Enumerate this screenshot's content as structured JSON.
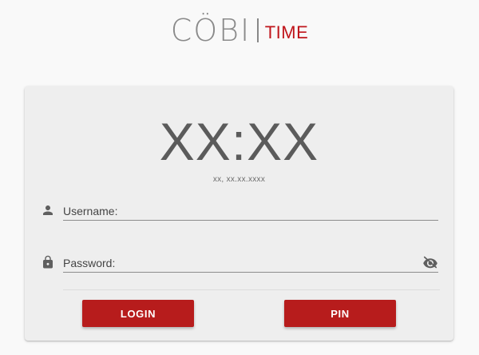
{
  "brand": {
    "logo_main": "CÖBI",
    "logo_sub": "TIME",
    "accent_color": "#c0161c"
  },
  "clock": {
    "time": "XX:XX",
    "date": "xx, xx.xx.xxxx"
  },
  "form": {
    "username_placeholder": "Username:",
    "password_placeholder": "Password:"
  },
  "buttons": {
    "login_label": "LOGIN",
    "pin_label": "PIN",
    "color": "#b71c1c"
  },
  "icons": {
    "username": "person-icon",
    "password": "lock-icon",
    "toggle_visibility": "eye-off-icon"
  }
}
